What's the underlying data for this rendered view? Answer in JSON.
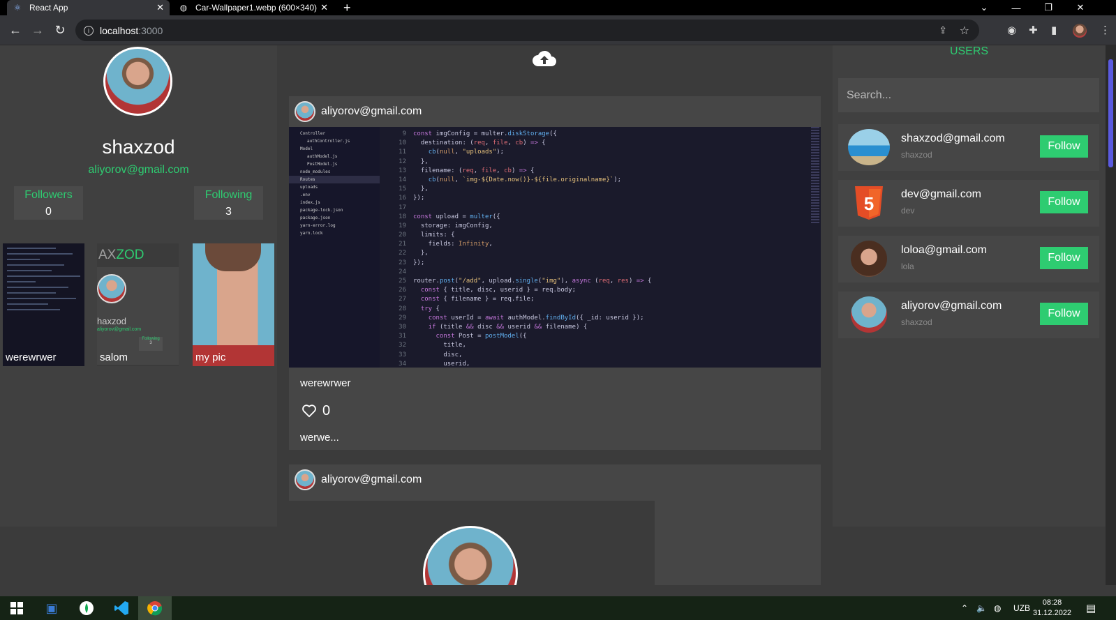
{
  "browser": {
    "tabs": [
      {
        "title": "React App",
        "active": true,
        "icon": "react-icon"
      },
      {
        "title": "Car-Wallpaper1.webp (600×340)",
        "active": false,
        "icon": "globe-icon"
      }
    ],
    "url_host": "localhost",
    "url_port": ":3000"
  },
  "profile": {
    "username": "shaxzod",
    "email": "aliyorov@gmail.com",
    "followers_label": "Followers",
    "followers_count": "0",
    "following_label": "Following",
    "following_count": "3"
  },
  "gallery": [
    {
      "caption": "werewrwer"
    },
    {
      "caption": "salom",
      "mini_title_a": "AX",
      "mini_title_b": "ZOD",
      "mini_name": "haxzod",
      "mini_email": "aliyorov@gmail.com",
      "mini_stat_label": "Following",
      "mini_stat_value": "3"
    },
    {
      "caption": "my pic"
    }
  ],
  "feed": {
    "posts": [
      {
        "author_email": "aliyorov@gmail.com",
        "title": "werewrwer",
        "likes": "0",
        "description": "werwe...",
        "explorer": [
          "Controller",
          "authController.js",
          "Model",
          "authModel.js",
          "PostModel.js",
          "node_modules",
          "Routes",
          "uploads",
          ".env",
          "index.js",
          "package-lock.json",
          "package.json",
          "yarn-error.log",
          "yarn.lock"
        ],
        "line_numbers": [
          "9",
          "10",
          "11",
          "12",
          "13",
          "14",
          "15",
          "16",
          "17",
          "18",
          "19",
          "20",
          "21",
          "22",
          "23",
          "24",
          "25",
          "26",
          "27",
          "28",
          "29",
          "30",
          "31",
          "32",
          "33",
          "34"
        ]
      },
      {
        "author_email": "aliyorov@gmail.com"
      }
    ]
  },
  "users": {
    "title": "USERS",
    "search_placeholder": "Search...",
    "list": [
      {
        "email": "shaxzod@gmail.com",
        "name": "shaxzod",
        "follow_label": "Follow",
        "avatar": "car-avatar"
      },
      {
        "email": "dev@gmail.com",
        "name": "dev",
        "follow_label": "Follow",
        "avatar": "html5-avatar"
      },
      {
        "email": "loloa@gmail.com",
        "name": "lola",
        "follow_label": "Follow",
        "avatar": "woman-avatar"
      },
      {
        "email": "aliyorov@gmail.com",
        "name": "shaxzod",
        "follow_label": "Follow",
        "avatar": "man-avatar"
      }
    ]
  },
  "taskbar": {
    "lang": "UZB",
    "time": "08:28",
    "date": "31.12.2022"
  },
  "colors": {
    "accent_green": "#2ecc71",
    "panel": "#404040",
    "card": "#464646"
  }
}
